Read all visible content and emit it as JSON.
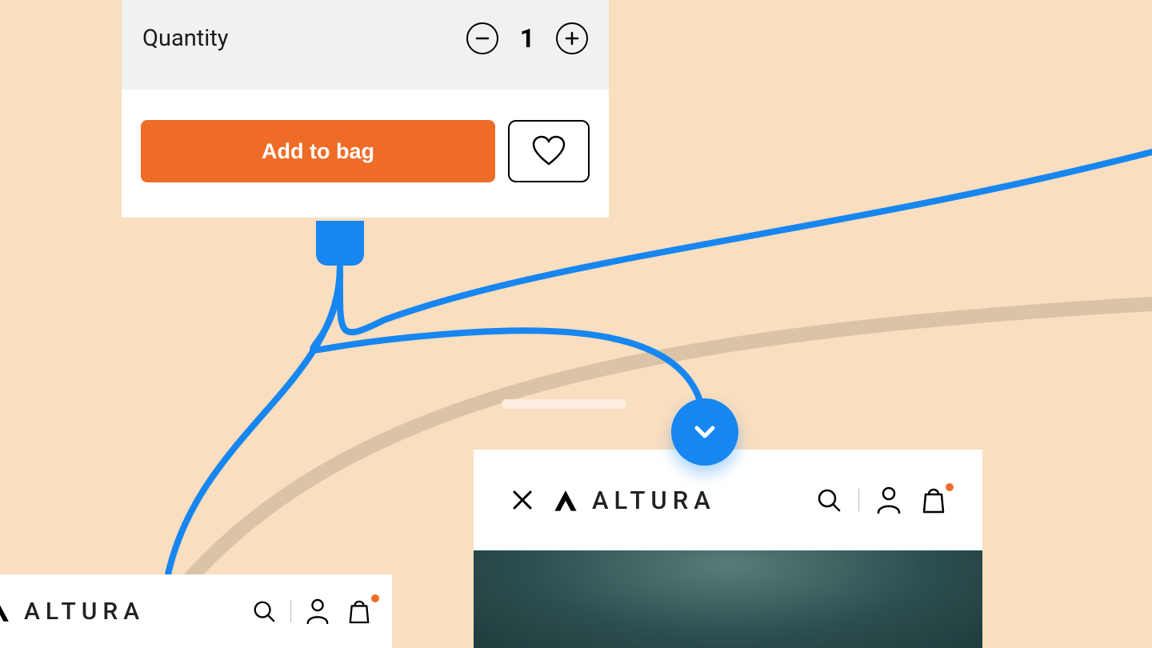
{
  "product_card": {
    "quantity_label": "Quantity",
    "quantity_value": "1",
    "add_to_bag_label": "Add to bag"
  },
  "storefront_main": {
    "brand_name": "ALTURA"
  },
  "storefront_cropped": {
    "brand_name": "ALTURA"
  },
  "colors": {
    "accent_orange": "#EF6C27",
    "connector_blue": "#1786F0",
    "background_peach": "#F9DEBF",
    "notification_dot": "#EF6C27"
  },
  "icons": {
    "minus": "minus-icon",
    "plus": "plus-icon",
    "heart": "heart-icon",
    "close": "close-icon",
    "search": "search-icon",
    "account": "account-icon",
    "bag": "bag-icon",
    "chevron_down": "chevron-down-icon",
    "brand_mark": "brand-logo-icon"
  }
}
